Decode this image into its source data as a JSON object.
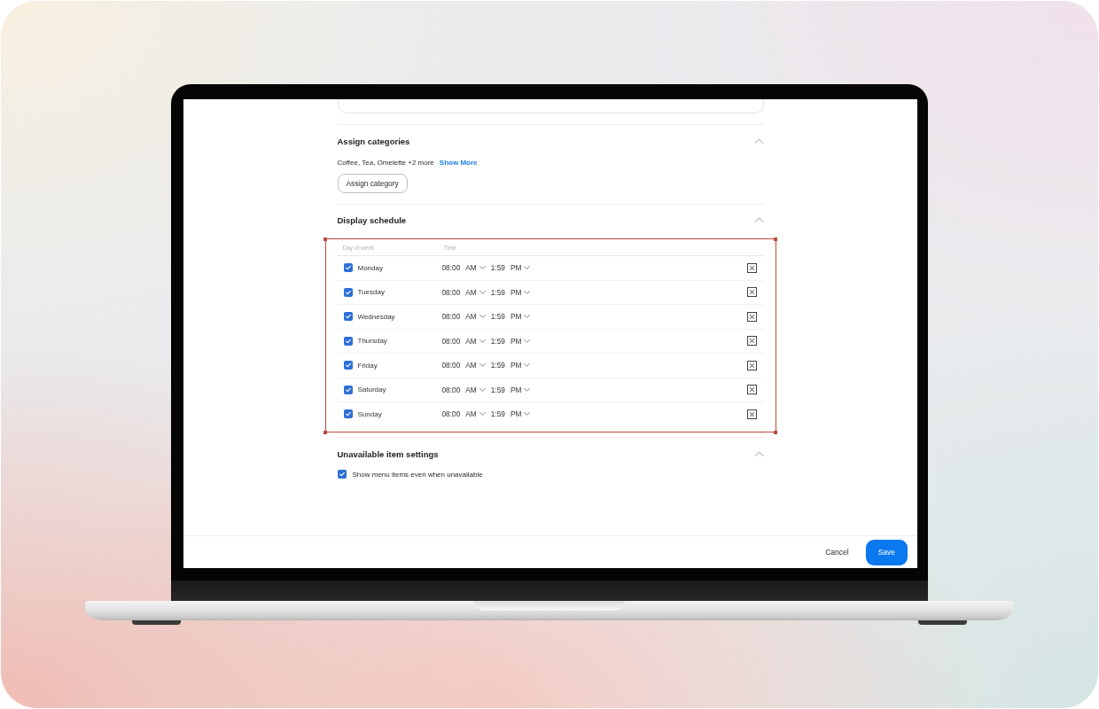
{
  "sections": [
    {
      "kind": "categories",
      "title": "Assign categories",
      "expanded": true,
      "summary": "Coffee, Tea, Omelette +2 more",
      "link": "Show More",
      "button": "Assign category"
    },
    {
      "kind": "schedule",
      "title": "Display schedule",
      "expanded": true,
      "highlighted": true,
      "columns": [
        "Day of week",
        "Time"
      ],
      "rows": [
        {
          "day": "Monday",
          "checked": true,
          "start_time": "08:00",
          "start_period": "AM",
          "end_time": "1:59",
          "end_period": "PM"
        },
        {
          "day": "Tuesday",
          "checked": true,
          "start_time": "08:00",
          "start_period": "AM",
          "end_time": "1:59",
          "end_period": "PM"
        },
        {
          "day": "Wednesday",
          "checked": true,
          "start_time": "08:00",
          "start_period": "AM",
          "end_time": "1:59",
          "end_period": "PM"
        },
        {
          "day": "Thursday",
          "checked": true,
          "start_time": "08:00",
          "start_period": "AM",
          "end_time": "1:59",
          "end_period": "PM"
        },
        {
          "day": "Friday",
          "checked": true,
          "start_time": "08:00",
          "start_period": "AM",
          "end_time": "1:59",
          "end_period": "PM"
        },
        {
          "day": "Saturday",
          "checked": true,
          "start_time": "08:00",
          "start_period": "AM",
          "end_time": "1:59",
          "end_period": "PM"
        },
        {
          "day": "Sunday",
          "checked": true,
          "start_time": "08:00",
          "start_period": "AM",
          "end_time": "1:59",
          "end_period": "PM"
        }
      ]
    },
    {
      "kind": "unavailable",
      "title": "Unavailable item settings",
      "expanded": true,
      "option": {
        "label": "Show menu items even when unavailable",
        "checked": true
      }
    }
  ],
  "footer": {
    "buttons": [
      {
        "label": "Cancel",
        "kind": "secondary"
      },
      {
        "label": "Save",
        "kind": "primary"
      }
    ]
  }
}
